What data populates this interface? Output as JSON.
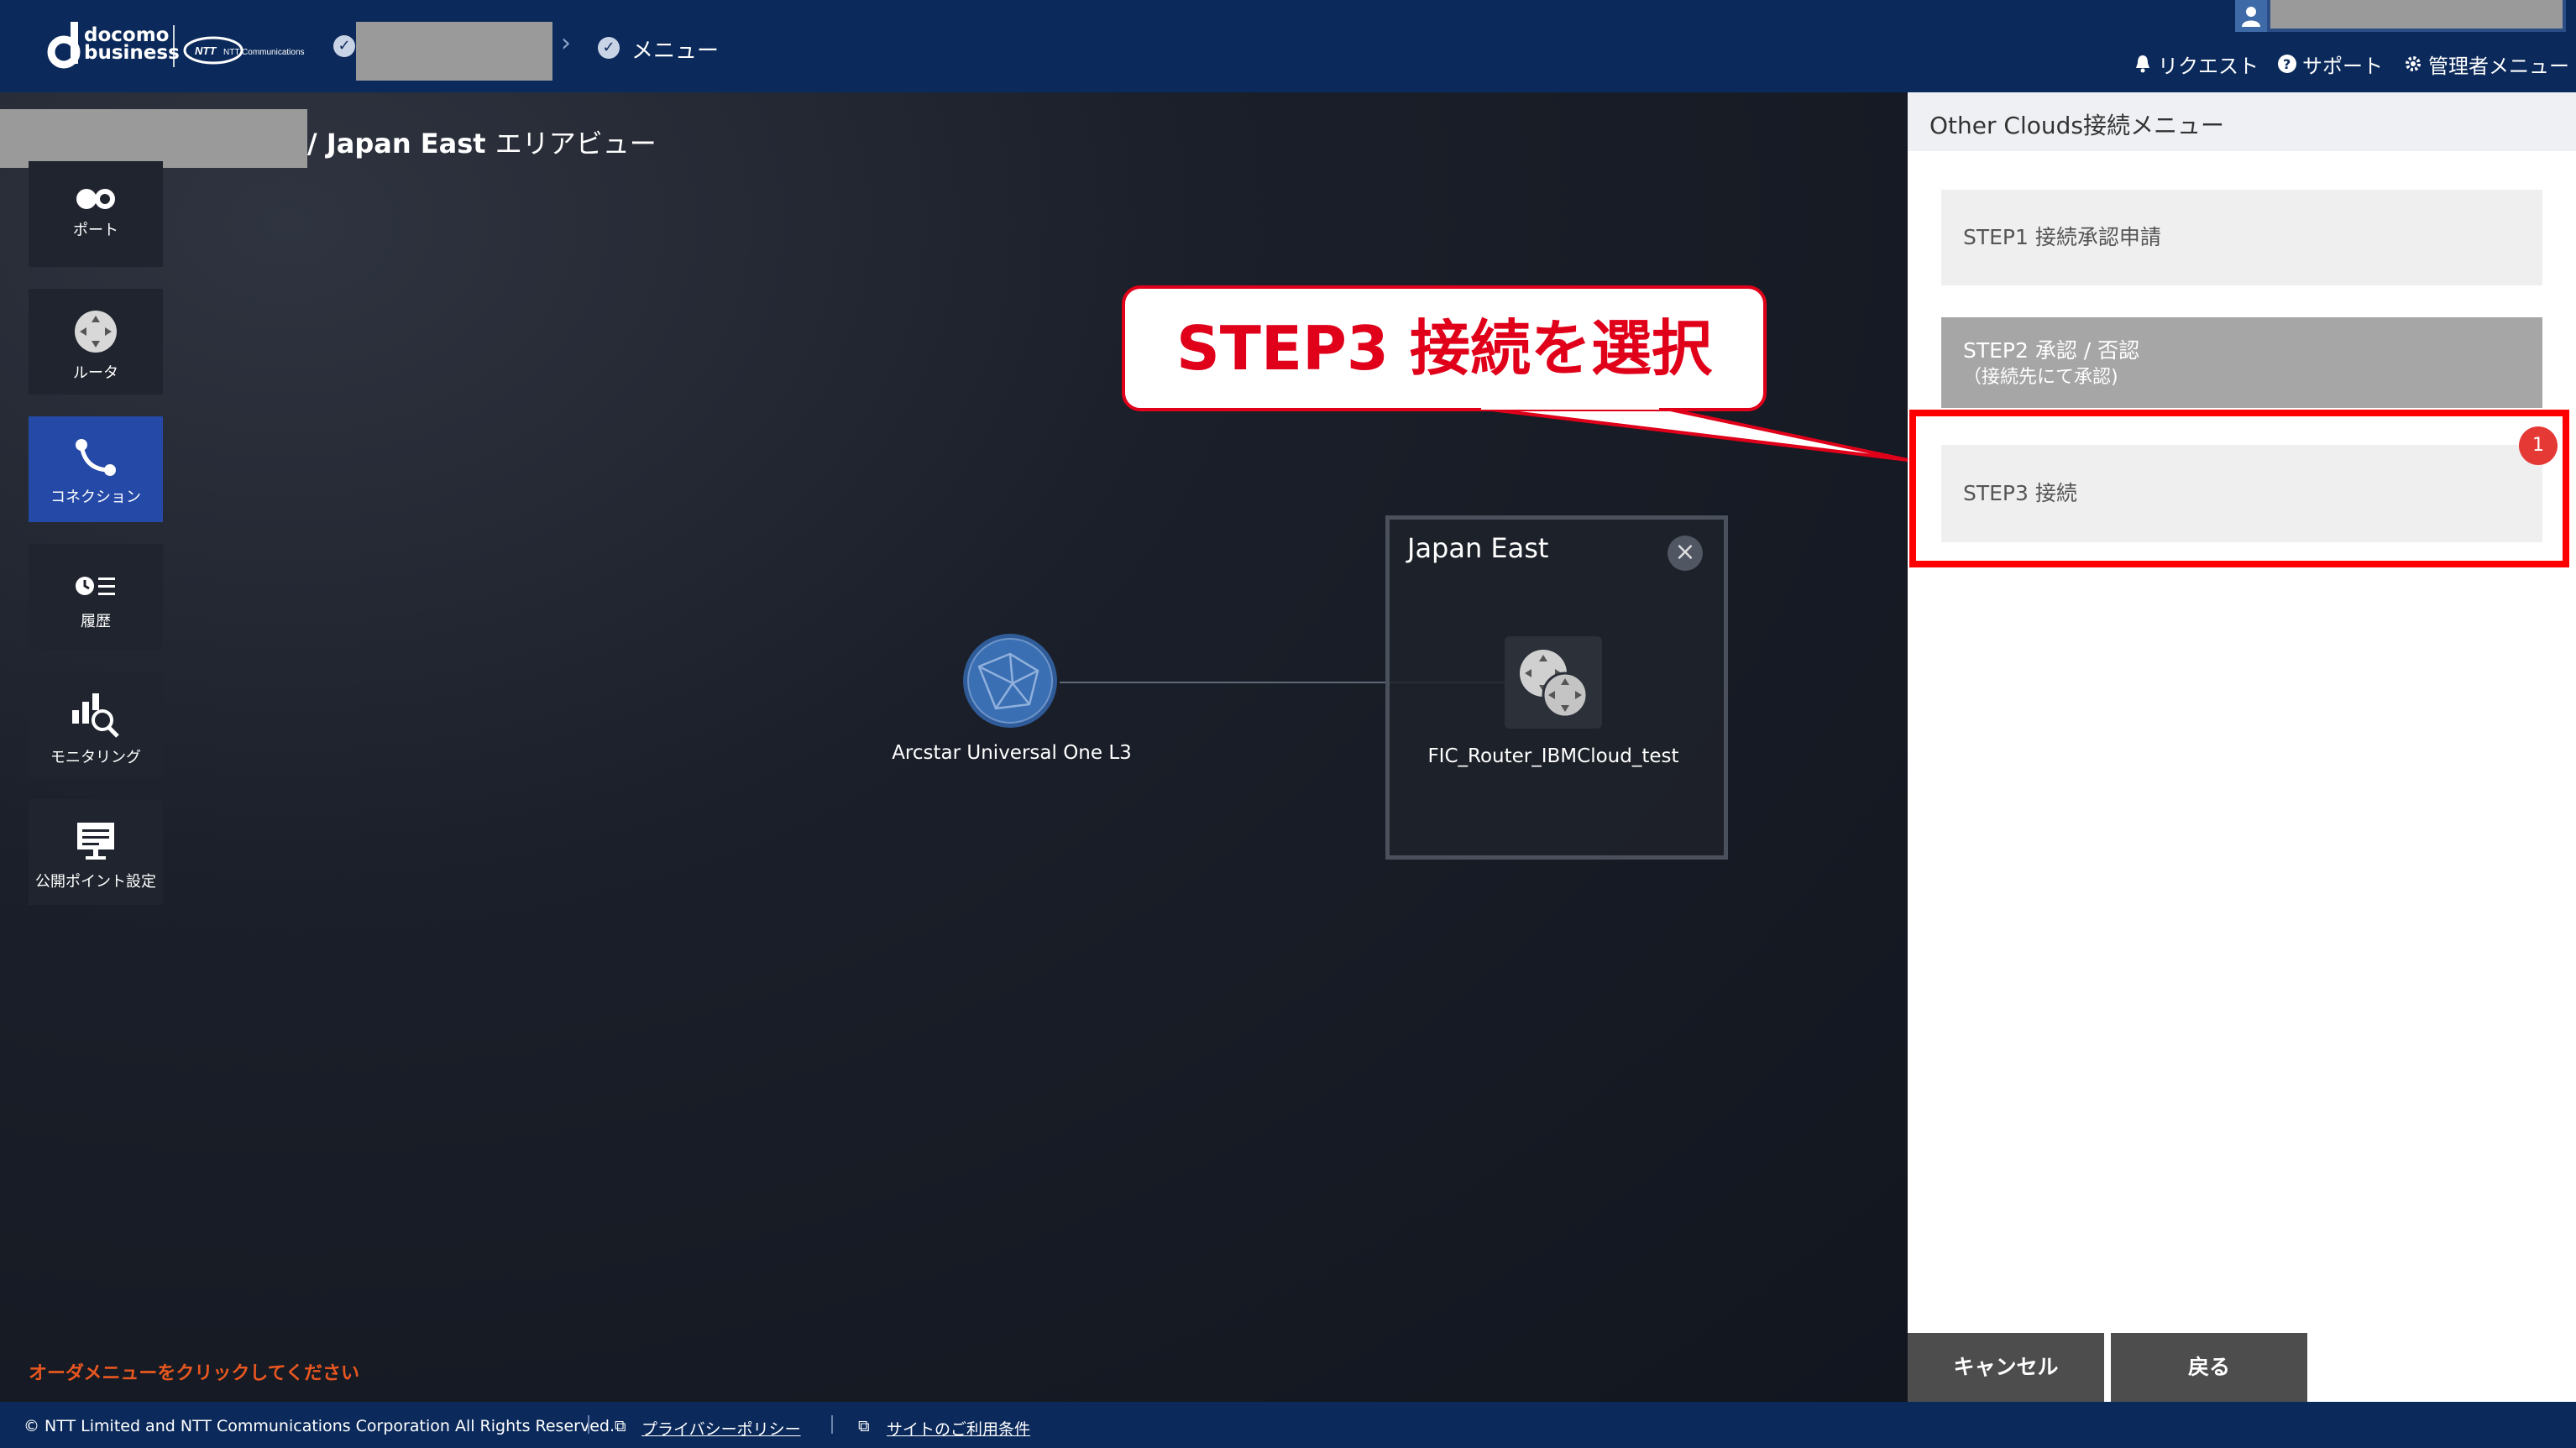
{
  "header": {
    "brand_line1": "docomo",
    "brand_line2": "business",
    "ntt_logo": "NTT Communications",
    "breadcrumb_menu": "メニュー",
    "links": {
      "request": "リクエスト",
      "support": "サポート",
      "admin": "管理者メニュー"
    }
  },
  "page": {
    "title_en": "/ Japan East",
    "title_jp": "エリアビュー"
  },
  "sidebar": {
    "items": [
      {
        "label": "ポート",
        "icon": "port-icon"
      },
      {
        "label": "ルータ",
        "icon": "router-icon"
      },
      {
        "label": "コネクション",
        "icon": "connection-icon"
      },
      {
        "label": "履歴",
        "icon": "history-icon"
      },
      {
        "label": "モニタリング",
        "icon": "monitoring-icon"
      },
      {
        "label": "公開ポイント設定",
        "icon": "public-point-icon"
      }
    ]
  },
  "diagram": {
    "node_globe_label": "Arcstar Universal One L3",
    "area_title": "Japan East",
    "router_label": "FIC_Router_IBMCloud_test"
  },
  "order_hint": "オーダメニューをクリックしてください",
  "callout": {
    "text": "STEP3 接続を選択"
  },
  "panel": {
    "title": "Other Clouds接続メニュー",
    "step1": "STEP1 接続承認申請",
    "step2_line1": "STEP2 承認 / 否認",
    "step2_line2": "（接続先にて承認)",
    "step3": "STEP3 接続",
    "step3_badge": "1",
    "cancel": "キャンセル",
    "back": "戻る"
  },
  "footer": {
    "copyright": "© NTT Limited and NTT Communications Corporation All Rights Reserved.",
    "privacy": "プライバシーポリシー",
    "terms": "サイトのご利用条件"
  },
  "colors": {
    "header_bg": "#0b2a5b",
    "sidebar_active": "#2449a7",
    "callout_red": "#e0001a",
    "highlight_red": "#ff0000",
    "badge_red": "#e53935",
    "order_hint": "#e8571f"
  }
}
